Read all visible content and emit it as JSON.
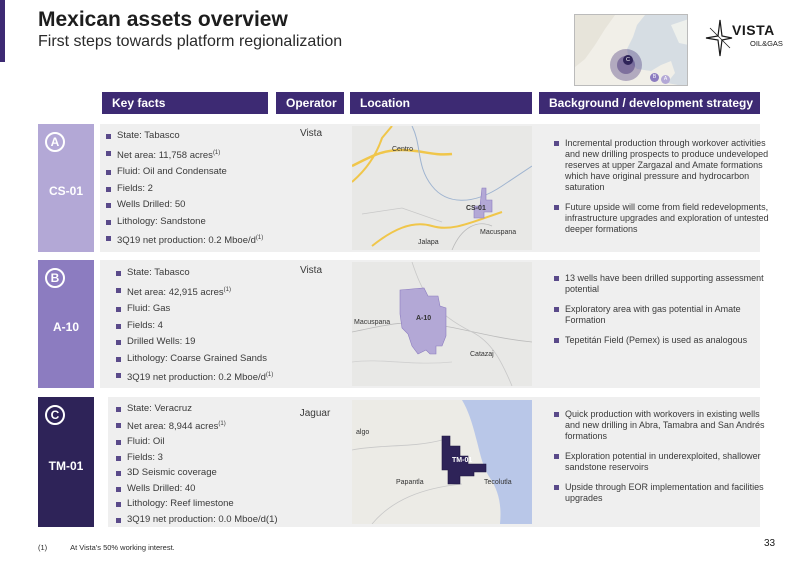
{
  "header": {
    "title": "Mexican assets overview",
    "subtitle": "First steps towards platform regionalization"
  },
  "logo": {
    "word": "VISTA",
    "sub": "OIL&GAS"
  },
  "mini_map": {
    "markers": [
      "C",
      "B",
      "A"
    ]
  },
  "columns": {
    "key_facts": "Key facts",
    "operator": "Operator",
    "location": "Location",
    "background": "Background / development strategy"
  },
  "assets": [
    {
      "letter": "A",
      "name": "CS-01",
      "badge_color": "#b3a8d6",
      "operator": "Vista",
      "facts": [
        "State: Tabasco",
        "Net area: 11,758 acres",
        "Fluid: Oil and Condensate",
        "Fields: 2",
        "Wells Drilled: 50",
        "Lithology: Sandstone",
        "3Q19 net production: 0.2 Mboe/d"
      ],
      "footnote_marks": {
        "1": "(1)",
        "6": "(1)"
      },
      "map_labels": [
        "Centro",
        "CS-01",
        "Jalapa",
        "Macuspana"
      ],
      "background": [
        "Incremental production through workover activities and new drilling prospects to produce undeveloped reserves at upper Zargazal and Amate formations which have original pressure and hydrocarbon saturation",
        "Future upside will come from field redevelopments, infrastructure upgrades and exploration of untested deeper formations"
      ]
    },
    {
      "letter": "B",
      "name": "A-10",
      "badge_color": "#8c7cc0",
      "operator": "Vista",
      "facts": [
        "State: Tabasco",
        "Net area: 42,915 acres",
        "Fluid: Gas",
        "Fields: 4",
        "Drilled Wells: 19",
        "Lithology: Coarse Grained Sands",
        "3Q19 net production: 0.2 Mboe/d"
      ],
      "footnote_marks": {
        "1": "(1)",
        "6": "(1)"
      },
      "map_labels": [
        "Macuspana",
        "A-10",
        "Catazaj"
      ],
      "background": [
        "13 wells have been drilled supporting assessment potential",
        "Exploratory area with gas potential in Amate Formation",
        "Tepetitán Field (Pemex) is used as analogous"
      ]
    },
    {
      "letter": "C",
      "name": "TM-01",
      "badge_color": "#2e2358",
      "operator": "Jaguar",
      "facts": [
        "State: Veracruz",
        "Net area: 8,944 acres",
        "Fluid: Oil",
        "Fields: 3",
        "3D Seismic coverage",
        "Wells Drilled: 40",
        "Lithology: Reef limestone",
        "3Q19 net production: 0.0 Mboe/d(1)"
      ],
      "footnote_marks": {
        "1": "(1)"
      },
      "map_labels": [
        "algo",
        "TM-01",
        "Papantla",
        "Tecolutla"
      ],
      "background": [
        "Quick production with workovers in existing wells and new drilling in Abra, Tamabra and San Andrés formations",
        "Exploration potential in underexploited, shallower sandstone reservoirs",
        "Upside through EOR implementation and facilities upgrades"
      ]
    }
  ],
  "footnote": {
    "number": "(1)",
    "text": "At Vista's 50% working interest."
  },
  "page_number": "33"
}
